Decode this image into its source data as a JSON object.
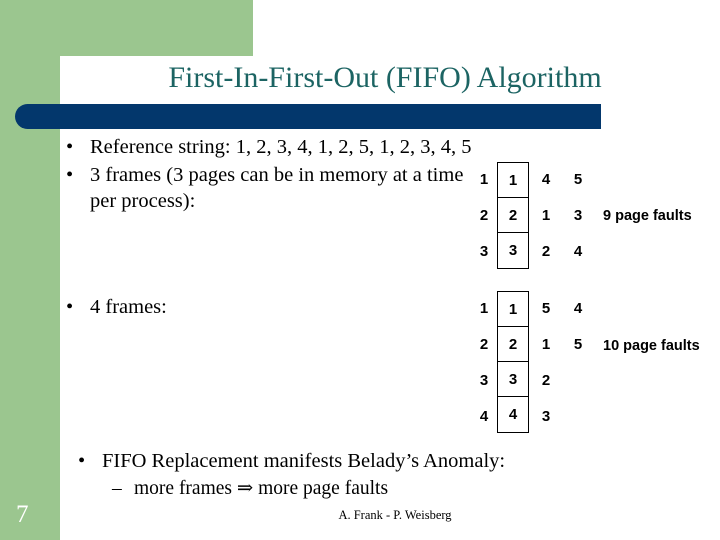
{
  "slide": {
    "title": "First-In-First-Out (FIFO) Algorithm",
    "page_number": "7",
    "footer_credit": "A. Frank - P. Weisberg",
    "colors": {
      "title_text": "#1c6463",
      "accent_green": "#9bc68f",
      "accent_blue": "#03376c",
      "body_text": "#000000",
      "page_number_text": "#ffffff"
    }
  },
  "bullets": {
    "reference_string": {
      "marker": "•",
      "text": "Reference string: 1, 2, 3, 4, 1, 2, 5, 1, 2, 3, 4, 5"
    },
    "three_frames": {
      "marker": "•",
      "text": "3 frames (3 pages can be in memory at a time per process):"
    },
    "four_frames": {
      "marker": "•",
      "text": "4 frames:"
    },
    "belady": {
      "marker": "•",
      "text": "FIFO Replacement manifests Belady’s Anomaly:"
    },
    "more_frames": {
      "marker": "–",
      "text": "more frames ⇒ more page faults"
    }
  },
  "diagrams": [
    {
      "id": "three-frames",
      "frames": 3,
      "faults_label": "9 page faults",
      "rows": [
        {
          "before": "1",
          "boxed": "1",
          "after1": "4",
          "after2": "5"
        },
        {
          "before": "2",
          "boxed": "2",
          "after1": "1",
          "after2": "3"
        },
        {
          "before": "3",
          "boxed": "3",
          "after1": "2",
          "after2": "4"
        }
      ]
    },
    {
      "id": "four-frames",
      "frames": 4,
      "faults_label": "10 page faults",
      "rows": [
        {
          "before": "1",
          "boxed": "1",
          "after1": "5",
          "after2": "4"
        },
        {
          "before": "2",
          "boxed": "2",
          "after1": "1",
          "after2": "5"
        },
        {
          "before": "3",
          "boxed": "3",
          "after1": "2",
          "after2": ""
        },
        {
          "before": "4",
          "boxed": "4",
          "after1": "3",
          "after2": ""
        }
      ]
    }
  ]
}
